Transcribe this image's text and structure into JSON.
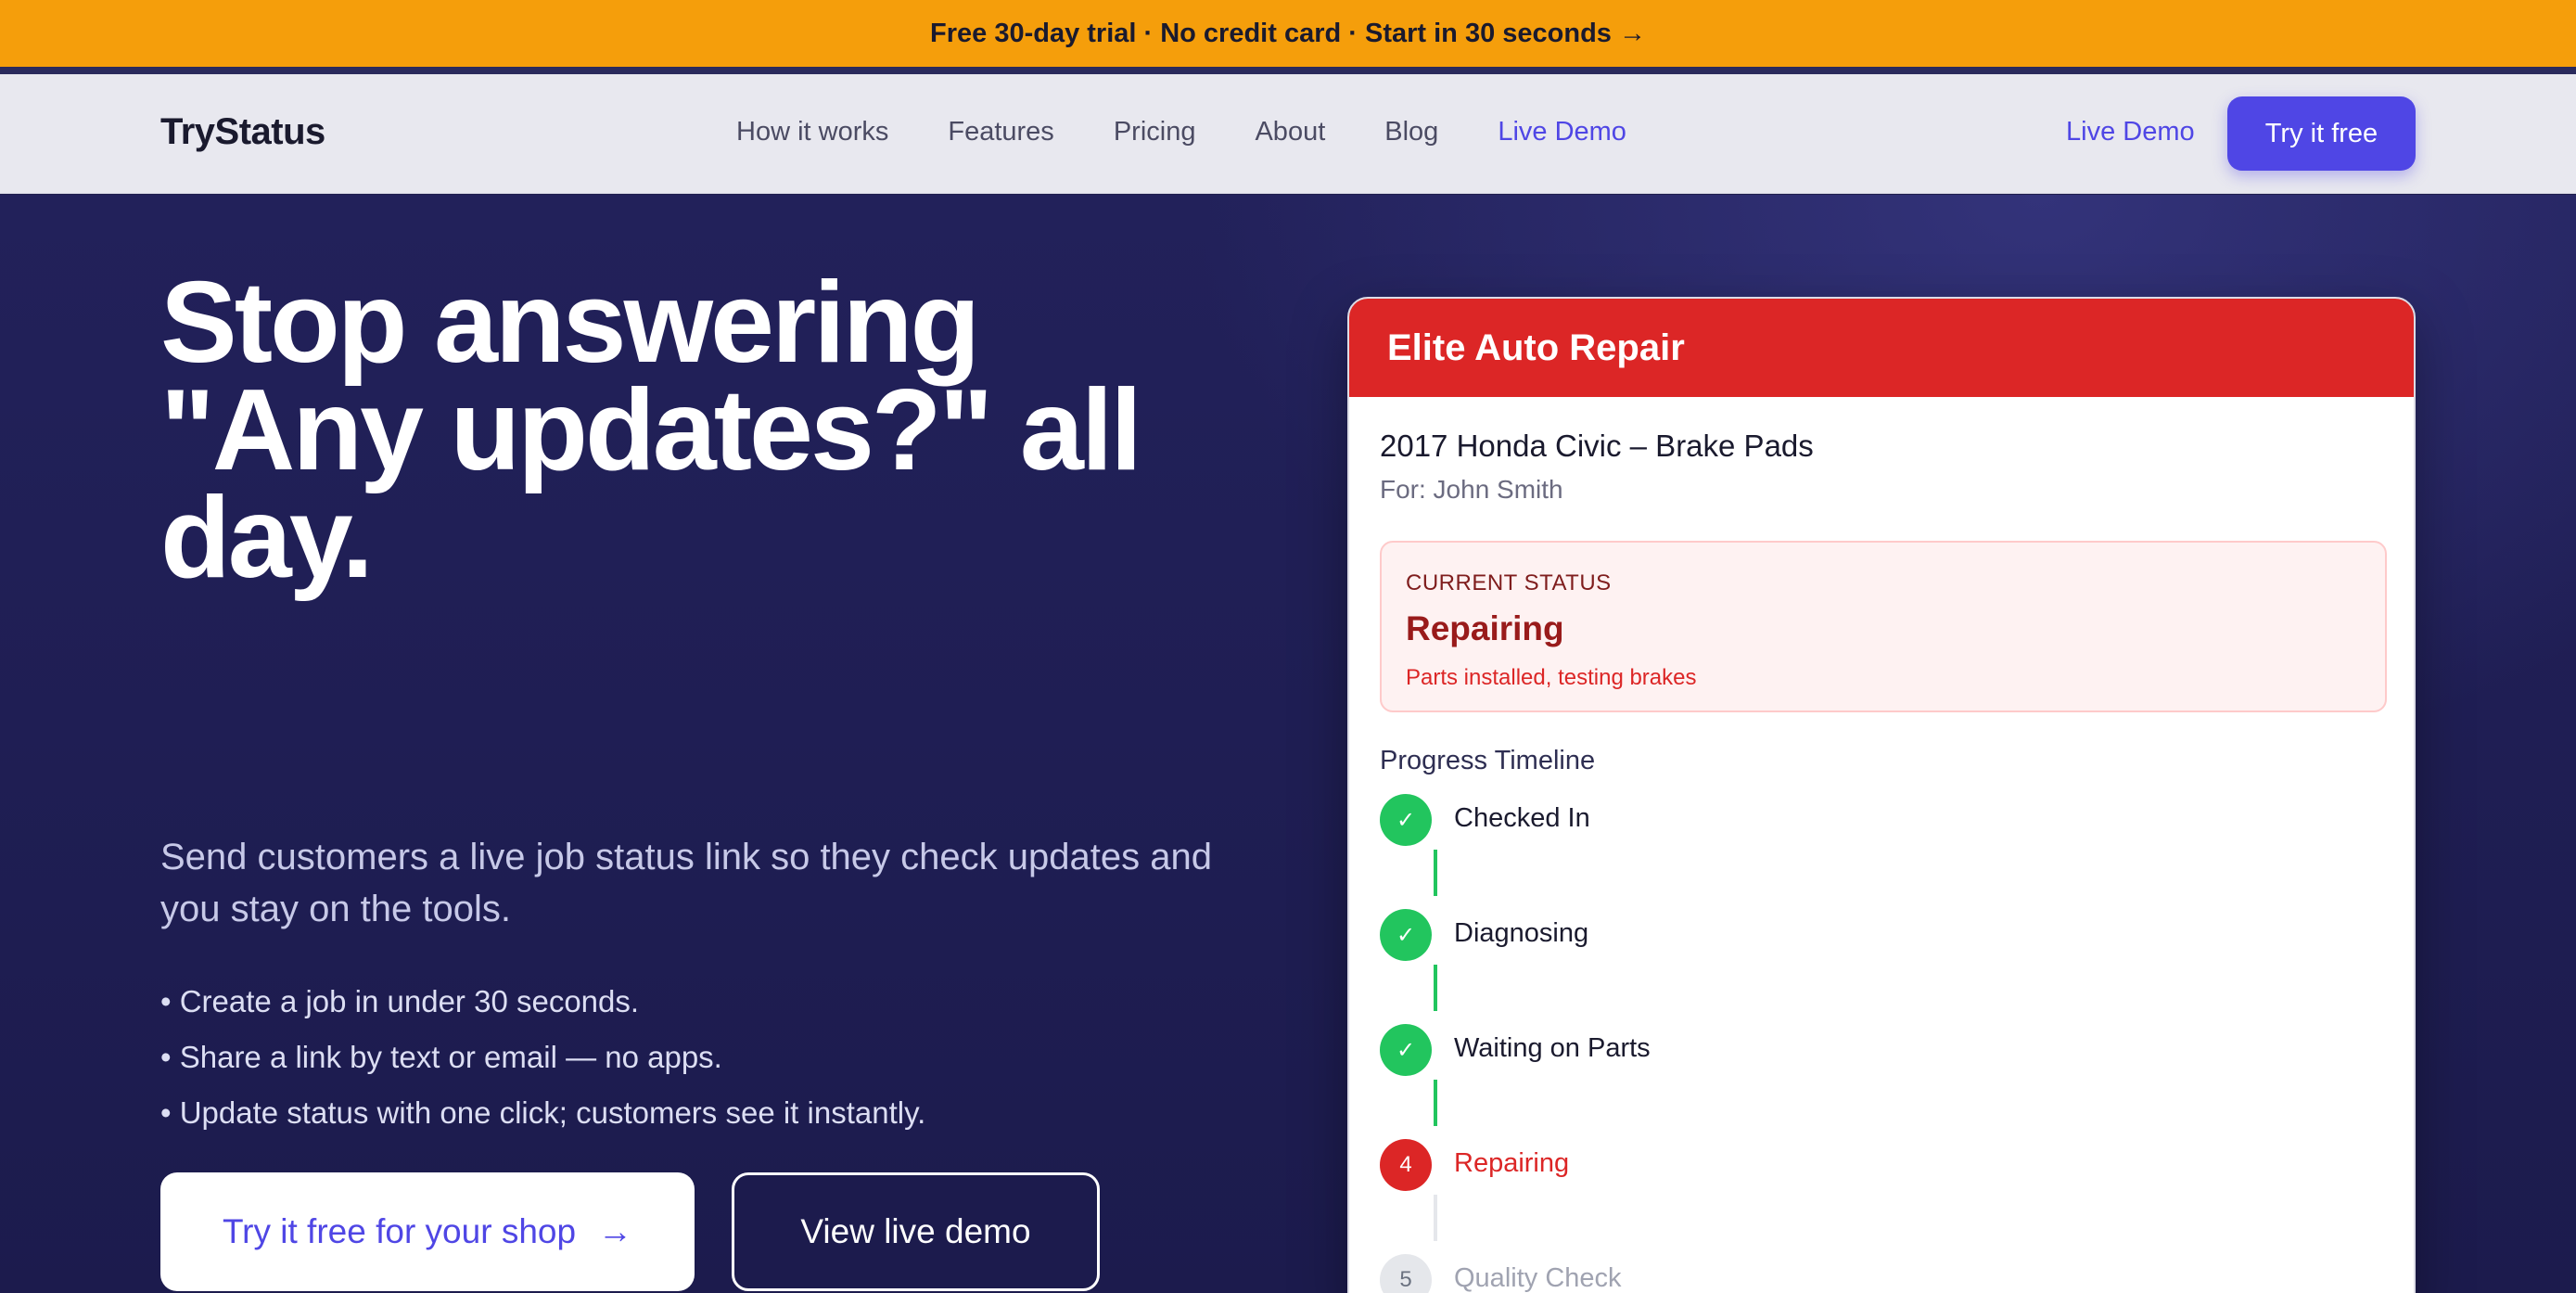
{
  "promo": {
    "text": "Free 30-day trial · No credit card · Start in 30 seconds →"
  },
  "nav": {
    "logo": "TryStatus",
    "links": [
      "How it works",
      "Features",
      "Pricing",
      "About",
      "Blog",
      "Live Demo"
    ],
    "live_demo": "Live Demo",
    "cta": "Try it free"
  },
  "hero": {
    "headline_line1": "Stop answering",
    "headline_line2": "\"Any updates?\" all",
    "headline_line3": "day.",
    "subhead": "Send customers a live job status link so they check updates and you stay on the tools.",
    "bullets": [
      "• Create a job in under 30 seconds.",
      "• Share a link by text or email — no apps.",
      "• Update status with one click; customers see it instantly."
    ],
    "primary_button": "Try it free for your shop",
    "primary_icon": "→",
    "secondary_button": "View live demo"
  },
  "card": {
    "shop_name": "Elite Auto Repair",
    "job_title": "2017 Honda Civic – Brake Pads",
    "customer": "For: John Smith",
    "status_caption": "CURRENT STATUS",
    "status_name": "Repairing",
    "status_detail": "Parts installed, testing brakes",
    "timeline_title": "Progress Timeline",
    "steps": [
      {
        "marker": "✓",
        "label": "Checked In",
        "state": "done"
      },
      {
        "marker": "✓",
        "label": "Diagnosing",
        "state": "done"
      },
      {
        "marker": "✓",
        "label": "Waiting on Parts",
        "state": "done"
      },
      {
        "marker": "4",
        "label": "Repairing",
        "state": "current"
      },
      {
        "marker": "5",
        "label": "Quality Check",
        "state": "pending"
      }
    ]
  },
  "colors": {
    "promo": "#f59e0b",
    "accent": "#4f46e5",
    "card_header": "#dc2626",
    "done": "#22c55e",
    "hero_bg": "#1e1d4d"
  }
}
